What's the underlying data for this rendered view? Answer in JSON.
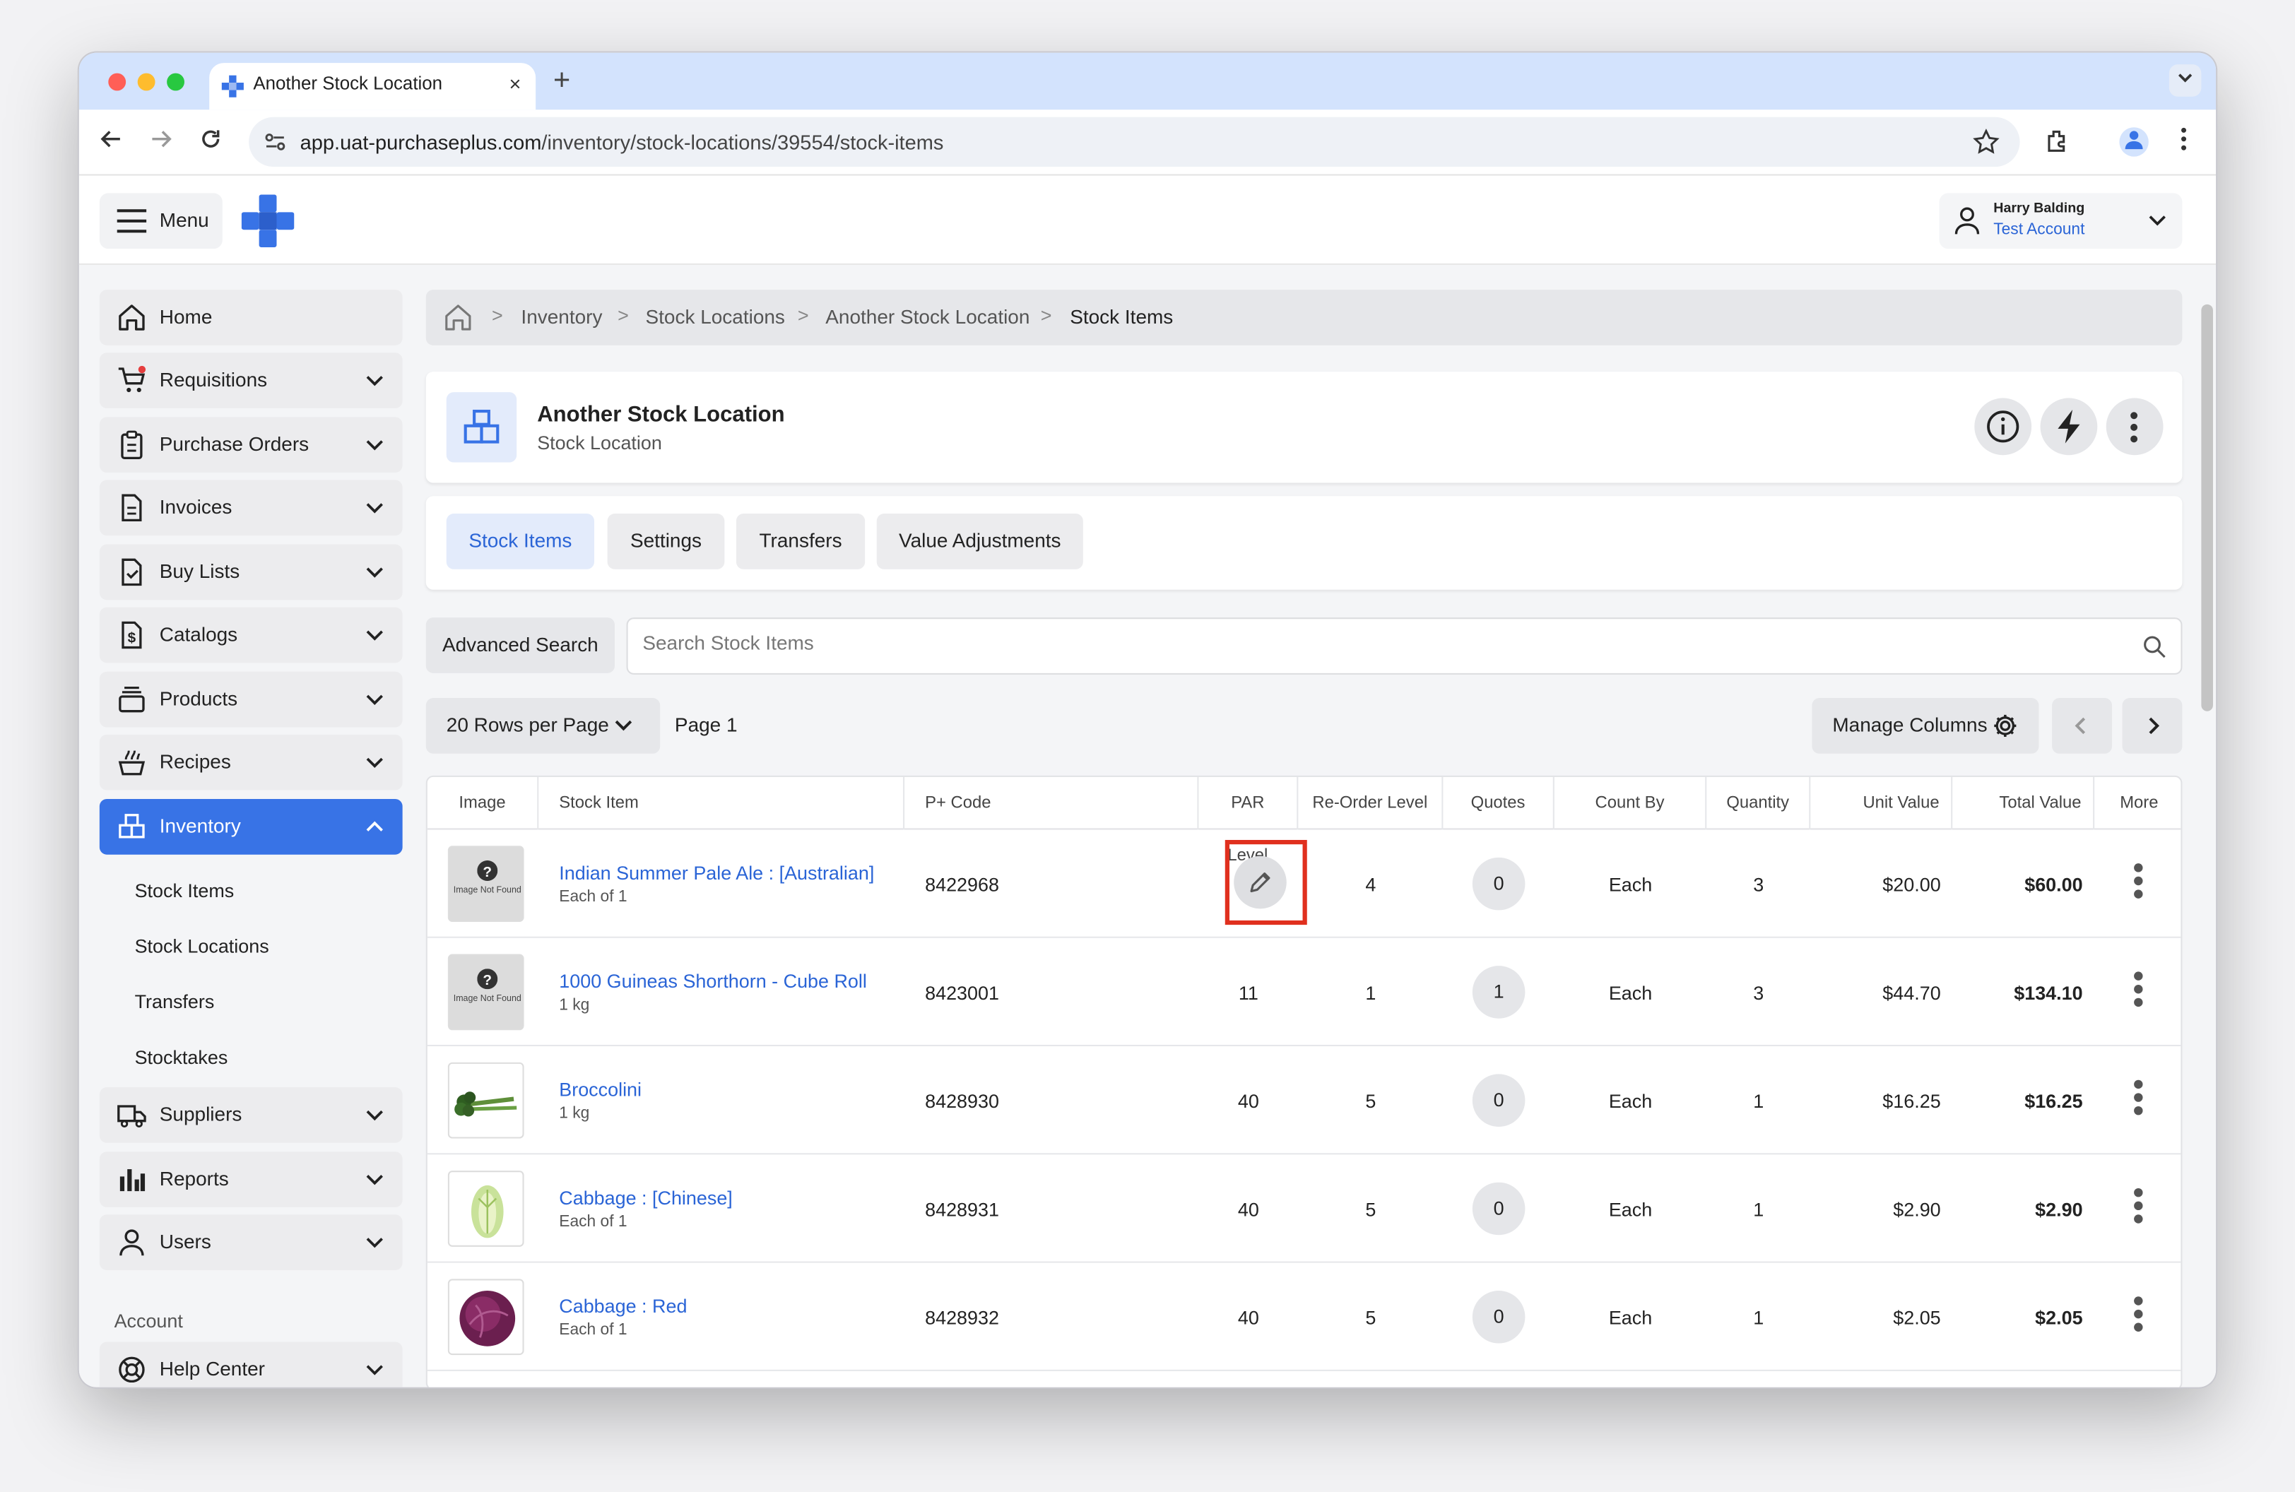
{
  "browser": {
    "tab_title": "Another Stock Location",
    "new_tab": "+",
    "close": "×",
    "url_domain": "app.uat-purchaseplus.com",
    "url_path": "/inventory/stock-locations/39554/stock-items"
  },
  "topbar": {
    "menu_label": "Menu",
    "user_name": "Harry Balding",
    "user_account": "Test Account"
  },
  "sidebar": {
    "items": [
      {
        "label": "Home",
        "icon": "home-icon"
      },
      {
        "label": "Requisitions",
        "icon": "cart-icon"
      },
      {
        "label": "Purchase Orders",
        "icon": "clipboard-icon"
      },
      {
        "label": "Invoices",
        "icon": "document-icon"
      },
      {
        "label": "Buy Lists",
        "icon": "checklist-icon"
      },
      {
        "label": "Catalogs",
        "icon": "dollar-doc-icon"
      },
      {
        "label": "Products",
        "icon": "stack-icon"
      },
      {
        "label": "Recipes",
        "icon": "pot-icon"
      },
      {
        "label": "Inventory",
        "icon": "boxes-icon"
      },
      {
        "label": "Suppliers",
        "icon": "truck-icon"
      },
      {
        "label": "Reports",
        "icon": "bar-chart-icon"
      },
      {
        "label": "Users",
        "icon": "user-icon"
      },
      {
        "label": "Help Center",
        "icon": "lifebuoy-icon"
      }
    ],
    "inventory_sub": [
      "Stock Items",
      "Stock Locations",
      "Transfers",
      "Stocktakes"
    ],
    "account_heading": "Account"
  },
  "breadcrumb": [
    "Inventory",
    "Stock Locations",
    "Another Stock Location",
    "Stock Items"
  ],
  "header": {
    "title": "Another Stock Location",
    "subtitle": "Stock Location"
  },
  "tabs": [
    "Stock Items",
    "Settings",
    "Transfers",
    "Value Adjustments"
  ],
  "toolbar": {
    "advanced_search": "Advanced Search",
    "search_placeholder": "Search Stock Items",
    "rows_per_page": "20 Rows per Page",
    "page": "Page 1",
    "manage_columns": "Manage Columns"
  },
  "table": {
    "columns": [
      "Image",
      "Stock Item",
      "P+ Code",
      "PAR Level",
      "Re-Order Level",
      "Quotes",
      "Count By",
      "Quantity",
      "Unit Value",
      "Total Value",
      "More"
    ],
    "image_not_found": "Image Not Found",
    "rows": [
      {
        "name": "Indian Summer Pale Ale : [Australian]",
        "unit": "Each of 1",
        "code": "8422968",
        "par": "",
        "reorder": "4",
        "quotes": "0",
        "count_by": "Each",
        "quantity": "3",
        "unit_value": "$20.00",
        "total_value": "$60.00",
        "image": "not-found"
      },
      {
        "name": "1000 Guineas Shorthorn - Cube Roll",
        "unit": "1 kg",
        "code": "8423001",
        "par": "11",
        "reorder": "1",
        "quotes": "1",
        "count_by": "Each",
        "quantity": "3",
        "unit_value": "$44.70",
        "total_value": "$134.10",
        "image": "not-found"
      },
      {
        "name": "Broccolini",
        "unit": "1 kg",
        "code": "8428930",
        "par": "40",
        "reorder": "5",
        "quotes": "0",
        "count_by": "Each",
        "quantity": "1",
        "unit_value": "$16.25",
        "total_value": "$16.25",
        "image": "broccolini"
      },
      {
        "name": "Cabbage : [Chinese]",
        "unit": "Each of 1",
        "code": "8428931",
        "par": "40",
        "reorder": "5",
        "quotes": "0",
        "count_by": "Each",
        "quantity": "1",
        "unit_value": "$2.90",
        "total_value": "$2.90",
        "image": "chinese-cabbage"
      },
      {
        "name": "Cabbage : Red",
        "unit": "Each of 1",
        "code": "8428932",
        "par": "40",
        "reorder": "5",
        "quotes": "0",
        "count_by": "Each",
        "quantity": "1",
        "unit_value": "$2.05",
        "total_value": "$2.05",
        "image": "red-cabbage"
      }
    ]
  },
  "colors": {
    "accent": "#3873e6",
    "link": "#2a64d6",
    "highlight": "#e0301e",
    "tabbar": "#d3e3fd"
  }
}
